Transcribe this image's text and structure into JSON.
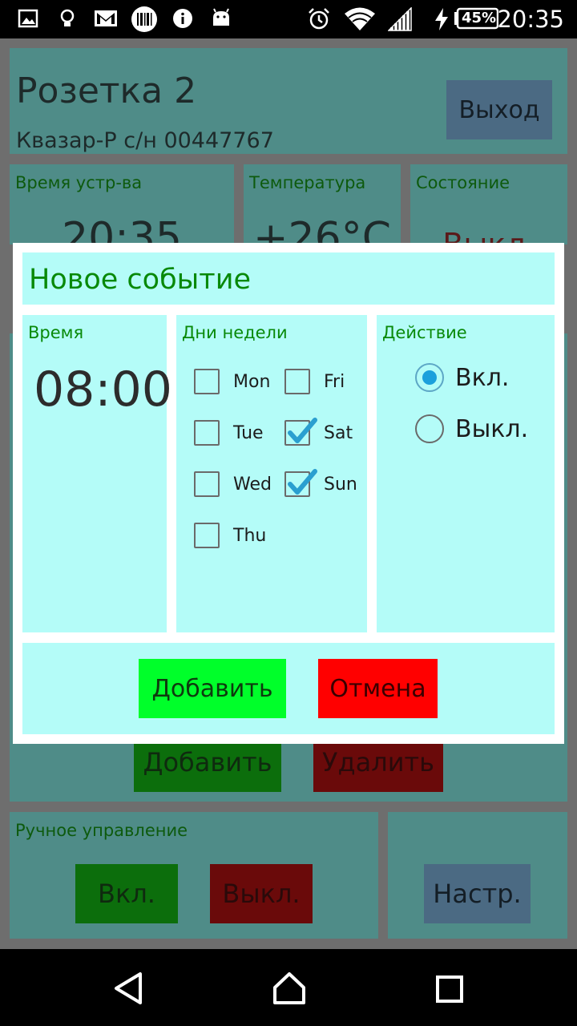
{
  "status_bar": {
    "clock": "20:35",
    "battery_percent": "45%",
    "icons": [
      "image-icon",
      "lightbulb-icon",
      "gmail-icon",
      "barcode-icon",
      "info-icon",
      "android-icon",
      "alarm-icon",
      "wifi-icon",
      "signal-icon",
      "charging-icon",
      "battery-icon"
    ]
  },
  "header": {
    "device_name": "Розетка 2",
    "serial": "Квазар-Р с/н 00447767",
    "exit_label": "Выход"
  },
  "info_panels": [
    {
      "label": "Время устр-ва",
      "value": "20:35"
    },
    {
      "label": "Температура",
      "value": "+26°C"
    },
    {
      "label": "Состояние",
      "value": "Выкл."
    }
  ],
  "schedule_actions": {
    "add_label": "Добавить",
    "delete_label": "Удалить"
  },
  "manual_control": {
    "label": "Ручное управление",
    "on_label": "Вкл.",
    "off_label": "Выкл.",
    "settings_label": "Настр."
  },
  "dialog": {
    "title": "Новое событие",
    "time_label": "Время",
    "time_value": "08:00",
    "days_label": "Дни недели",
    "days": [
      {
        "label": "Mon",
        "checked": false
      },
      {
        "label": "Tue",
        "checked": false
      },
      {
        "label": "Wed",
        "checked": false
      },
      {
        "label": "Thu",
        "checked": false
      },
      {
        "label": "Fri",
        "checked": false
      },
      {
        "label": "Sat",
        "checked": true
      },
      {
        "label": "Sun",
        "checked": true
      }
    ],
    "action_label": "Действие",
    "actions": [
      {
        "label": "Вкл.",
        "selected": true
      },
      {
        "label": "Выкл.",
        "selected": false
      }
    ],
    "add_button": "Добавить",
    "cancel_button": "Отмена"
  },
  "colors": {
    "dialog_box": "#b4fcf8",
    "title_green": "#088908",
    "add_green": "#00ff2a",
    "cancel_red": "#ff0000",
    "checkmark": "#2a9fd0"
  }
}
